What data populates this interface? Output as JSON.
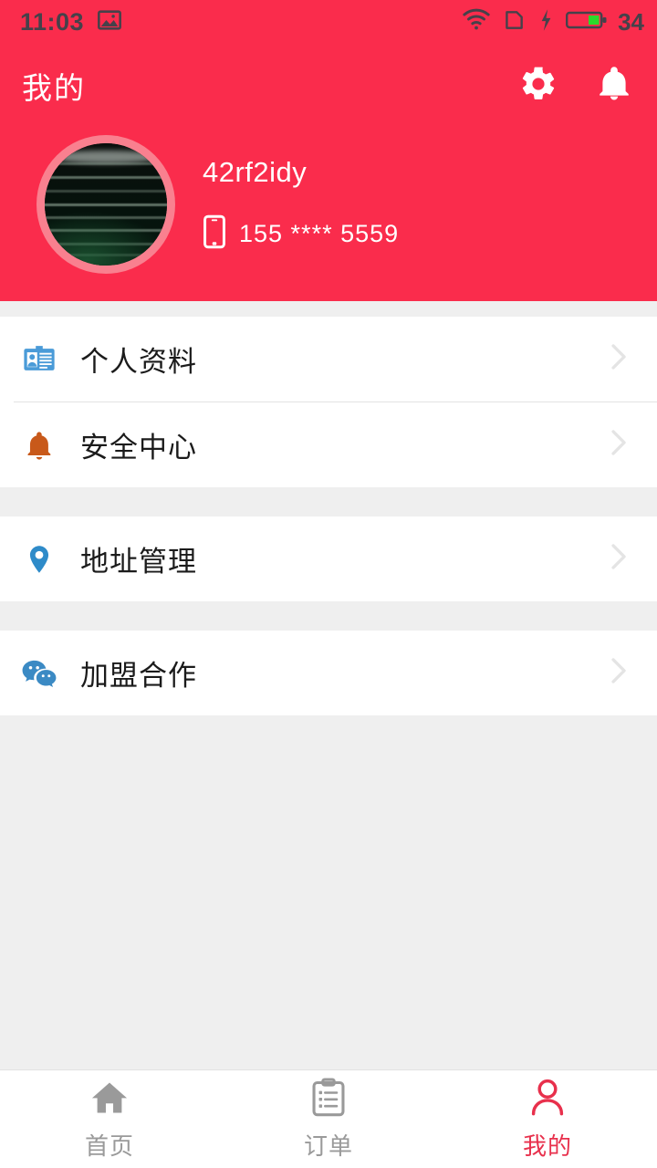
{
  "theme": {
    "primary": "#fa2c4c",
    "accent_active": "#e8304c",
    "page_bg": "#efefef",
    "card_bg": "#ffffff",
    "text_primary": "#1b1b1b",
    "text_muted": "#9a9a9a",
    "icon_blue": "#4a9bd8",
    "icon_orange": "#c8591a",
    "icon_wechat": "#3b8ac4",
    "avatar_ring": "#f9808f"
  },
  "statusbar": {
    "time": "11:03",
    "image_icon": "image-icon",
    "wifi_icon": "wifi-icon",
    "sim_icon": "sim-card-icon",
    "charging_icon": "charging-bolt-icon",
    "battery_icon": "battery-icon",
    "battery_level": "34"
  },
  "header": {
    "title": "我的",
    "settings_icon": "gear-icon",
    "notifications_icon": "bell-icon",
    "profile": {
      "avatar_alt": "user-avatar",
      "username": "42rf2idy",
      "phone_icon": "smartphone-icon",
      "phone": "155 **** 5559"
    }
  },
  "menu_groups": [
    {
      "items": [
        {
          "label": "个人资料",
          "icon": "id-card-icon",
          "chevron": "chevron-right-icon"
        },
        {
          "label": "安全中心",
          "icon": "bell-icon",
          "chevron": "chevron-right-icon"
        }
      ]
    },
    {
      "items": [
        {
          "label": "地址管理",
          "icon": "location-pin-icon",
          "chevron": "chevron-right-icon"
        }
      ]
    },
    {
      "items": [
        {
          "label": "加盟合作",
          "icon": "wechat-bubbles-icon",
          "chevron": "chevron-right-icon"
        }
      ]
    }
  ],
  "bottom_nav": {
    "items": [
      {
        "label": "首页",
        "icon": "home-icon",
        "active": false
      },
      {
        "label": "订单",
        "icon": "clipboard-list-icon",
        "active": false
      },
      {
        "label": "我的",
        "icon": "person-icon",
        "active": true
      }
    ]
  }
}
